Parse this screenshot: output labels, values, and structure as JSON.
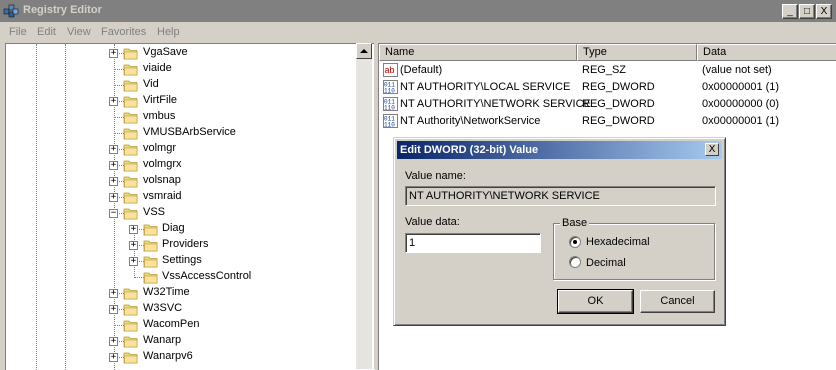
{
  "window": {
    "title": "Registry Editor",
    "controls": {
      "minimize": "_",
      "maximize": "□",
      "close": "X"
    }
  },
  "menu": [
    "File",
    "Edit",
    "View",
    "Favorites",
    "Help"
  ],
  "tree": {
    "items": [
      {
        "label": "VgaSave",
        "expander": "+"
      },
      {
        "label": "viaide",
        "expander": ""
      },
      {
        "label": "Vid",
        "expander": ""
      },
      {
        "label": "VirtFile",
        "expander": "+"
      },
      {
        "label": "vmbus",
        "expander": ""
      },
      {
        "label": "VMUSBArbService",
        "expander": ""
      },
      {
        "label": "volmgr",
        "expander": "+"
      },
      {
        "label": "volmgrx",
        "expander": "+"
      },
      {
        "label": "volsnap",
        "expander": "+"
      },
      {
        "label": "vsmraid",
        "expander": "+"
      },
      {
        "label": "VSS",
        "expander": "−"
      },
      {
        "label": "Diag",
        "expander": "+"
      },
      {
        "label": "Providers",
        "expander": "+"
      },
      {
        "label": "Settings",
        "expander": "+"
      },
      {
        "label": "VssAccessControl",
        "expander": ""
      },
      {
        "label": "W32Time",
        "expander": "+"
      },
      {
        "label": "W3SVC",
        "expander": "+"
      },
      {
        "label": "WacomPen",
        "expander": ""
      },
      {
        "label": "Wanarp",
        "expander": "+"
      },
      {
        "label": "Wanarpv6",
        "expander": "+"
      }
    ]
  },
  "values_list": {
    "columns": [
      "Name",
      "Type",
      "Data"
    ],
    "rows": [
      {
        "icon": "string-value-icon",
        "name": "(Default)",
        "type": "REG_SZ",
        "data": "(value not set)"
      },
      {
        "icon": "binary-value-icon",
        "name": "NT AUTHORITY\\LOCAL SERVICE",
        "type": "REG_DWORD",
        "data": "0x00000001 (1)"
      },
      {
        "icon": "binary-value-icon",
        "name": "NT AUTHORITY\\NETWORK SERVICE",
        "type": "REG_DWORD",
        "data": "0x00000000 (0)"
      },
      {
        "icon": "binary-value-icon",
        "name": "NT Authority\\NetworkService",
        "type": "REG_DWORD",
        "data": "0x00000001 (1)"
      }
    ]
  },
  "dialog": {
    "title": "Edit DWORD (32-bit) Value",
    "close": "X",
    "value_name_label": "Value name:",
    "value_name": "NT AUTHORITY\\NETWORK SERVICE",
    "value_data_label": "Value data:",
    "value_data": "1",
    "base_label": "Base",
    "hex_label": "Hexadecimal",
    "dec_label": "Decimal",
    "base_selected": "Hexadecimal",
    "ok": "OK",
    "cancel": "Cancel"
  }
}
